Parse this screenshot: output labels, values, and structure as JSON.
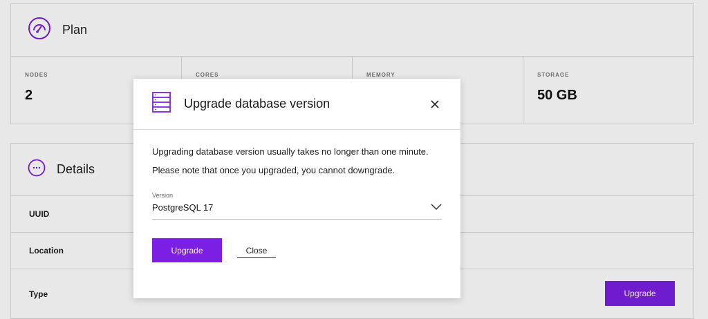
{
  "plan": {
    "title": "Plan",
    "stats": [
      {
        "label": "NODES",
        "value": "2"
      },
      {
        "label": "CORES",
        "value": ""
      },
      {
        "label": "MEMORY",
        "value": ""
      },
      {
        "label": "STORAGE",
        "value": "50 GB"
      }
    ]
  },
  "details": {
    "title": "Details",
    "rows": [
      {
        "label": "UUID"
      },
      {
        "label": "Location"
      },
      {
        "label": "Type"
      }
    ],
    "upgrade_label": "Upgrade"
  },
  "modal": {
    "title": "Upgrade database version",
    "description": "Upgrading database version usually takes no longer than one minute. Please note that once you upgraded, you cannot downgrade.",
    "version_label": "Version",
    "version_value": "PostgreSQL 17",
    "upgrade_label": "Upgrade",
    "close_label": "Close"
  },
  "colors": {
    "accent": "#7b1fe3"
  }
}
